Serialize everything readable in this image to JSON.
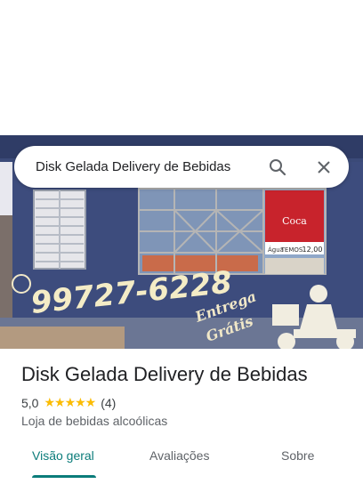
{
  "search": {
    "query": "Disk Gelada Delivery de Bebidas",
    "search_icon": "search-icon",
    "close_icon": "close-icon"
  },
  "photo": {
    "phone_text": "99727-6228",
    "wall_text_line1": "Entrega",
    "wall_text_line2": "Grátis",
    "window_sign_top": "Coca",
    "window_sign_mid": "TEMOS",
    "window_sign_price": "12,00",
    "window_sign_small": "Água"
  },
  "place": {
    "title": "Disk Gelada Delivery de Bebidas",
    "rating": "5,0",
    "stars": "★★★★★",
    "review_count": "(4)",
    "category": "Loja de bebidas alcoólicas"
  },
  "tabs": [
    {
      "label": "Visão geral",
      "active": true
    },
    {
      "label": "Avaliações",
      "active": false
    },
    {
      "label": "Sobre",
      "active": false
    }
  ],
  "colors": {
    "accent": "#0b7c7a",
    "star": "#fbbc04",
    "wall": "#3b4a78"
  }
}
